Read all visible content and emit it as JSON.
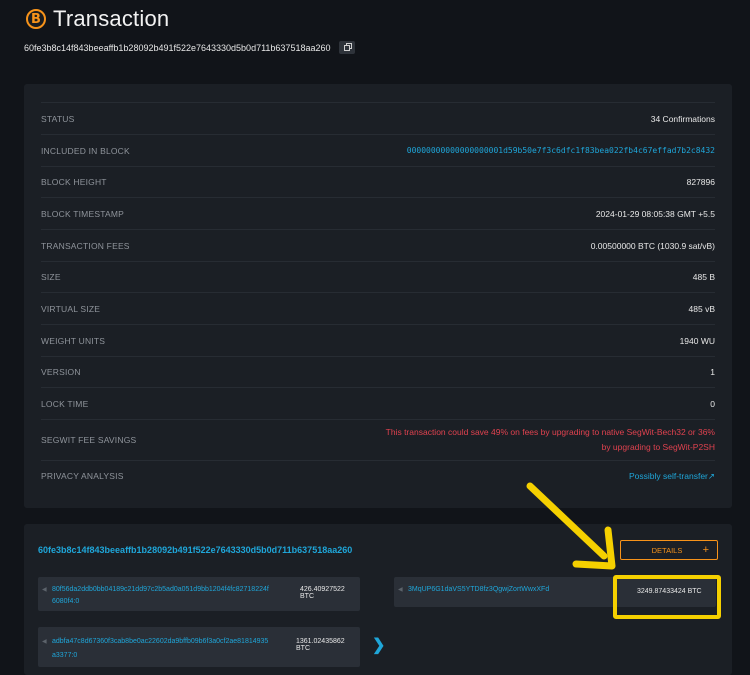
{
  "header": {
    "title": "Transaction",
    "logo_icon": "bitcoin-icon",
    "logo_text": "B"
  },
  "txid": "60fe3b8c14f843beeaffb1b28092b491f522e7643330d5b0d711b637518aa260",
  "details": [
    {
      "label": "STATUS",
      "value": "34 Confirmations",
      "style": "normal"
    },
    {
      "label": "INCLUDED IN BLOCK",
      "value": "00000000000000000001d59b50e7f3c6dfc1f83bea022fb4c67effad7b2c8432",
      "style": "link"
    },
    {
      "label": "BLOCK HEIGHT",
      "value": "827896",
      "style": "normal"
    },
    {
      "label": "BLOCK TIMESTAMP",
      "value": "2024-01-29 08:05:38 GMT +5.5",
      "style": "normal"
    },
    {
      "label": "TRANSACTION FEES",
      "value": "0.00500000 BTC (1030.9 sat/vB)",
      "style": "normal"
    },
    {
      "label": "SIZE",
      "value": "485 B",
      "style": "normal"
    },
    {
      "label": "VIRTUAL SIZE",
      "value": "485 vB",
      "style": "normal"
    },
    {
      "label": "WEIGHT UNITS",
      "value": "1940 WU",
      "style": "normal"
    },
    {
      "label": "VERSION",
      "value": "1",
      "style": "normal"
    },
    {
      "label": "LOCK TIME",
      "value": "0",
      "style": "normal"
    },
    {
      "label": "SEGWIT FEE SAVINGS",
      "value": "This transaction could save 49% on fees by upgrading to native SegWit-Bech32 or 36% by upgrading to SegWit-P2SH",
      "style": "warn"
    },
    {
      "label": "PRIVACY ANALYSIS",
      "value": "Possibly self-transfer↗",
      "style": "priv"
    }
  ],
  "io": {
    "txid": "60fe3b8c14f843beeaffb1b28092b491f522e7643330d5b0d711b637518aa260",
    "details_button": "DETAILS",
    "details_plus": "+",
    "inputs": [
      {
        "address": "80f56da2ddb0bb04189c21dd97c2b5ad0a051d9bb1204f4fc82718224f",
        "sub": "6080f4:0",
        "amount": "426.40927522 BTC"
      },
      {
        "address": "adbfa47c8d67360f3cab8be0ac22602da9bffb09b6f3a0cf2ae81814935",
        "sub": "a3377:0",
        "amount": "1361.02435862 BTC"
      }
    ],
    "output": {
      "address": "3MqUP6G1daVS5YTD8fz3QgwjZortWwxXFd",
      "amount": "3249.87433424 BTC"
    },
    "next_chevron": "❯"
  },
  "colors": {
    "accent": "#f7931a",
    "link": "#1fa6d9",
    "warning": "#e0424f",
    "annotation": "#f5d000"
  }
}
